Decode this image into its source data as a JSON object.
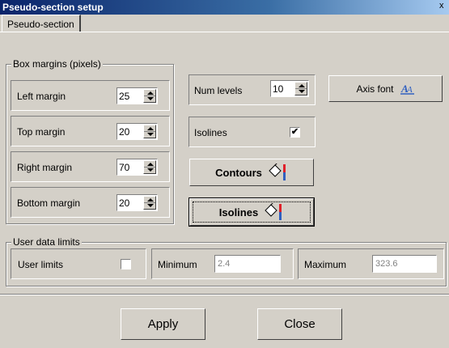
{
  "window": {
    "title": "Pseudo-section setup",
    "close_glyph": "x"
  },
  "tabs": [
    {
      "label": "Pseudo-section"
    }
  ],
  "box_margins": {
    "legend": "Box margins (pixels)",
    "left": {
      "label": "Left margin",
      "value": "25"
    },
    "top": {
      "label": "Top margin",
      "value": "20"
    },
    "right": {
      "label": "Right margin",
      "value": "70"
    },
    "bottom": {
      "label": "Bottom margin",
      "value": "20"
    }
  },
  "num_levels": {
    "label": "Num levels",
    "value": "10"
  },
  "axis_font": {
    "label": "Axis font",
    "icon": "font-a-icon"
  },
  "isolines_check": {
    "label": "Isolines",
    "checked": true,
    "mark": "✔"
  },
  "contours_button": {
    "label": "Contours",
    "icon": "paint-bucket-icon"
  },
  "isolines_button": {
    "label": "Isolines",
    "icon": "paint-bucket-icon"
  },
  "user_limits": {
    "legend": "User data limits",
    "check_label": "User limits",
    "checked": false,
    "min_label": "Minimum",
    "min_value": "2.4",
    "max_label": "Maximum",
    "max_value": "323.6"
  },
  "footer": {
    "apply_label": "Apply",
    "close_label": "Close"
  },
  "colors": {
    "title_start": "#0a246a",
    "title_end": "#a6caf0",
    "face": "#d4d0c8",
    "accent_red": "#e0202a",
    "accent_blue": "#3060c0"
  }
}
